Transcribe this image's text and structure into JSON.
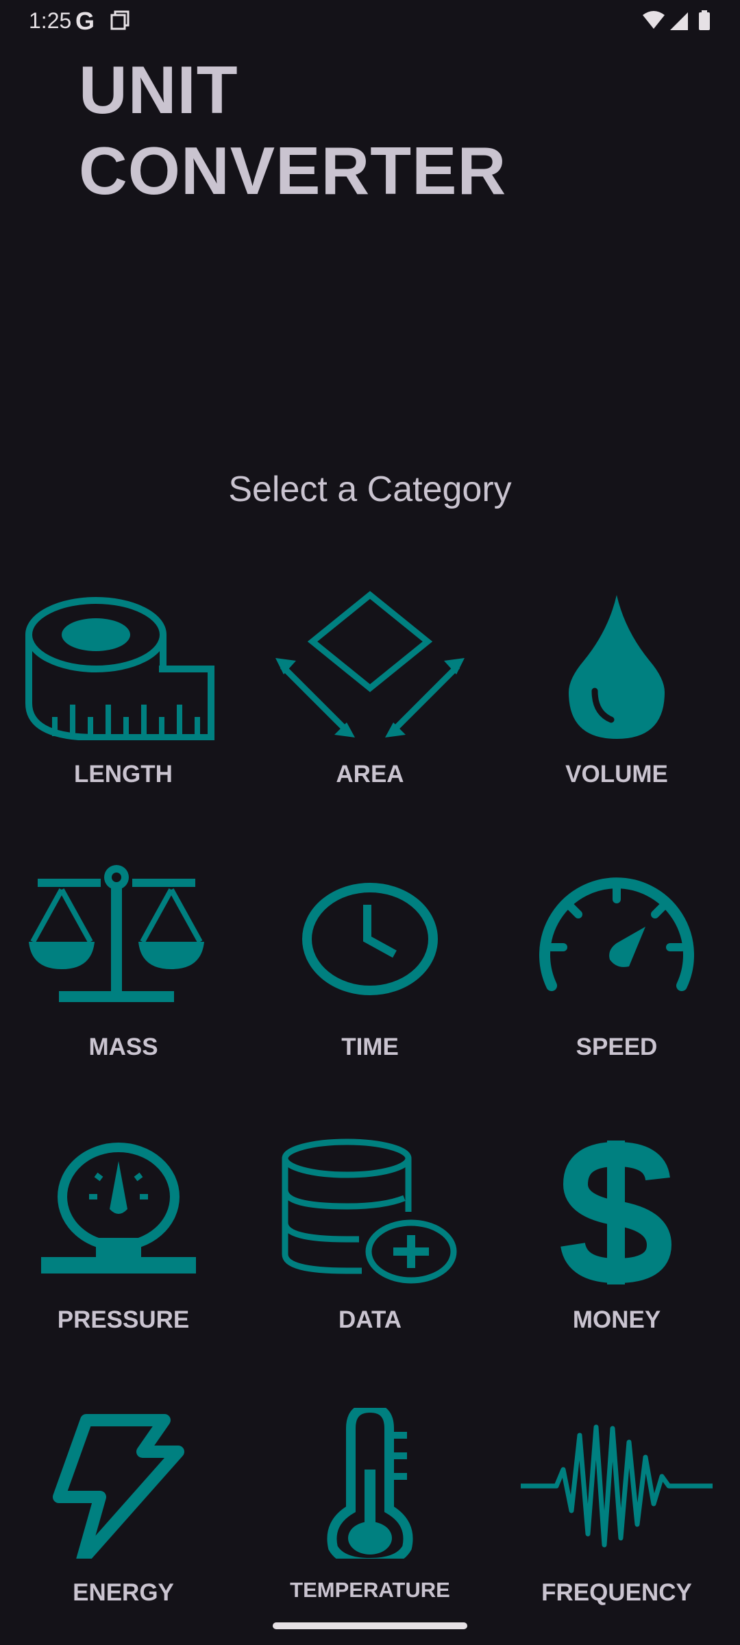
{
  "status_bar": {
    "time": "1:25",
    "google_glyph": "G"
  },
  "app": {
    "title_line1": "UNIT",
    "title_line2": "CONVERTER",
    "subtitle": "Select a Category",
    "accent_color": "#008080",
    "background_color": "#141218",
    "text_color": "#cac4d0"
  },
  "categories": [
    {
      "label": "LENGTH",
      "icon": "tape-measure-icon"
    },
    {
      "label": "AREA",
      "icon": "area-square-icon"
    },
    {
      "label": "VOLUME",
      "icon": "water-drop-icon"
    },
    {
      "label": "MASS",
      "icon": "balance-scale-icon"
    },
    {
      "label": "TIME",
      "icon": "clock-icon"
    },
    {
      "label": "SPEED",
      "icon": "speedometer-icon"
    },
    {
      "label": "PRESSURE",
      "icon": "pressure-gauge-icon"
    },
    {
      "label": "DATA",
      "icon": "database-plus-icon"
    },
    {
      "label": "MONEY",
      "icon": "dollar-icon"
    },
    {
      "label": "ENERGY",
      "icon": "lightning-bolt-icon"
    },
    {
      "label": "TEMPERATURE",
      "icon": "thermometer-icon"
    },
    {
      "label": "FREQUENCY",
      "icon": "waveform-icon"
    }
  ]
}
